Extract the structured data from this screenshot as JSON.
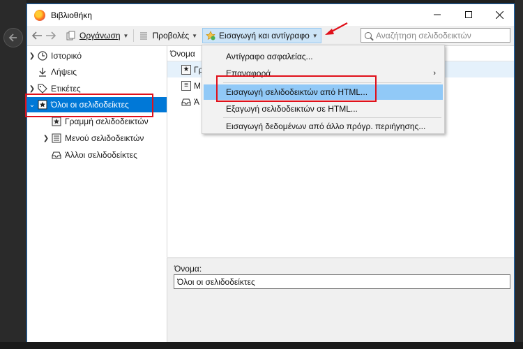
{
  "window": {
    "title": "Βιβλιοθήκη"
  },
  "toolbar": {
    "organize": "Οργάνωση",
    "views": "Προβολές",
    "import_backup": "Εισαγωγή και αντίγραφο",
    "search_placeholder": "Αναζήτηση σελιδοδεικτών"
  },
  "sidebar": {
    "items": [
      {
        "label": "Ιστορικό"
      },
      {
        "label": "Λήψεις"
      },
      {
        "label": "Ετικέτες"
      },
      {
        "label": "Όλοι οι σελιδοδείκτες"
      },
      {
        "label": "Γραμμή σελιδοδεικτών"
      },
      {
        "label": "Μενού σελιδοδεικτών"
      },
      {
        "label": "Άλλοι σελιδοδείκτες"
      }
    ]
  },
  "list": {
    "column_name": "Όνομα",
    "rows": [
      {
        "label": "Γρ"
      },
      {
        "label": "Μ"
      },
      {
        "label": "Ά"
      }
    ]
  },
  "menu": {
    "items": [
      {
        "label": "Αντίγραφο ασφαλείας..."
      },
      {
        "label": "Επαναφορά"
      },
      {
        "label": "Εισαγωγή σελιδοδεικτών από HTML..."
      },
      {
        "label": "Εξαγωγή σελιδοδεικτών σε HTML..."
      },
      {
        "label": "Εισαγωγή δεδομένων από άλλο πρόγρ. περιήγησης..."
      }
    ]
  },
  "details": {
    "name_label": "Όνομα:",
    "name_value": "Όλοι οι σελιδοδείκτες"
  },
  "colors": {
    "accent": "#0078d7",
    "highlight": "#91c9f7",
    "annotation": "#e0101a"
  }
}
